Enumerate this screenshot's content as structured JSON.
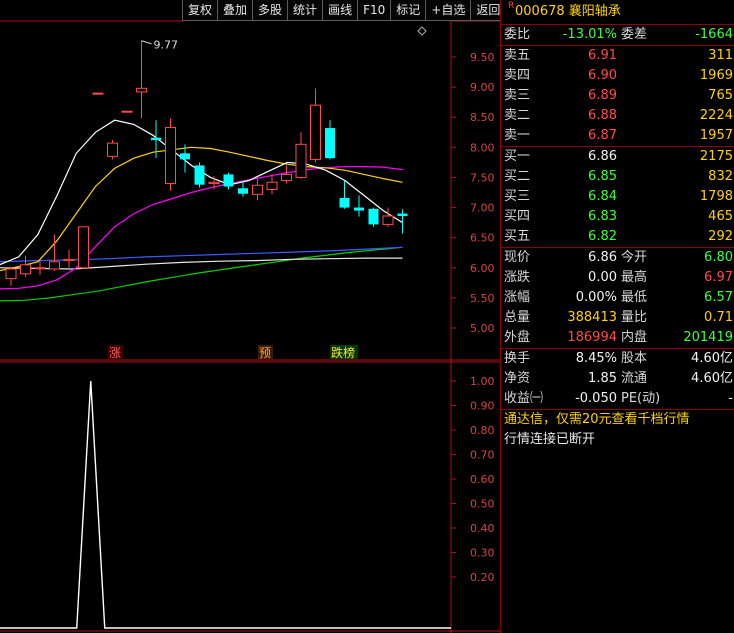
{
  "toolbar": [
    "复权",
    "叠加",
    "多股",
    "统计",
    "画线",
    "F10",
    "标记",
    "+自选",
    "返回"
  ],
  "chart": {
    "price_ticks": [
      "9.50",
      "9.00",
      "8.50",
      "8.00",
      "7.50",
      "7.00",
      "6.50",
      "6.00",
      "5.50",
      "5.00"
    ],
    "ind_ticks": [
      "1.00",
      "0.90",
      "0.80",
      "0.70",
      "0.60",
      "0.50",
      "0.40",
      "0.30",
      "0.20"
    ],
    "high_marker": "9.77",
    "tags": [
      "涨",
      "预",
      "跌榜"
    ],
    "colors": {
      "up": "#ff4a4a",
      "down": "#00ffff",
      "ma5": "#ffffff",
      "ma10": "#ffd200",
      "ma20": "#ff00ff",
      "ma60": "#00d000",
      "ma_blue": "#3c5cff",
      "axis": "#b0121b"
    }
  },
  "chart_data": {
    "type": "candlestick",
    "y_price_ticks": [
      9.5,
      9.0,
      8.5,
      8.0,
      7.5,
      7.0,
      6.5,
      6.0,
      5.5,
      5.0
    ],
    "y_indicator_ticks": [
      1.0,
      0.9,
      0.8,
      0.7,
      0.6,
      0.5,
      0.4,
      0.3,
      0.2
    ],
    "high_annotation": 9.77,
    "candles": [
      {
        "o": 5.82,
        "c": 5.98,
        "h": 6.02,
        "l": 5.7
      },
      {
        "o": 5.9,
        "c": 6.05,
        "h": 6.2,
        "l": 5.85
      },
      {
        "o": 6.0,
        "c": 6.0,
        "h": 6.12,
        "l": 5.88
      },
      {
        "o": 5.98,
        "c": 6.1,
        "h": 6.55,
        "l": 5.95
      },
      {
        "o": 6.12,
        "c": 6.14,
        "h": 6.3,
        "l": 6.0
      },
      {
        "o": 6.0,
        "c": 6.68,
        "h": 6.68,
        "l": 5.98
      },
      {
        "o": 8.9,
        "c": 8.9,
        "h": 8.9,
        "l": 8.9
      },
      {
        "o": 7.85,
        "c": 8.07,
        "h": 8.12,
        "l": 7.8
      },
      {
        "o": 8.6,
        "c": 8.6,
        "h": 8.6,
        "l": 8.6
      },
      {
        "o": 8.92,
        "c": 8.98,
        "h": 9.77,
        "l": 8.48
      },
      {
        "o": 8.16,
        "c": 8.12,
        "h": 8.45,
        "l": 7.82
      },
      {
        "o": 7.4,
        "c": 8.33,
        "h": 8.48,
        "l": 7.28
      },
      {
        "o": 7.9,
        "c": 7.8,
        "h": 8.05,
        "l": 7.58
      },
      {
        "o": 7.7,
        "c": 7.38,
        "h": 7.75,
        "l": 7.33
      },
      {
        "o": 7.4,
        "c": 7.42,
        "h": 7.52,
        "l": 7.3
      },
      {
        "o": 7.55,
        "c": 7.35,
        "h": 7.58,
        "l": 7.3
      },
      {
        "o": 7.32,
        "c": 7.23,
        "h": 7.45,
        "l": 7.18
      },
      {
        "o": 7.22,
        "c": 7.37,
        "h": 7.48,
        "l": 7.12
      },
      {
        "o": 7.3,
        "c": 7.42,
        "h": 7.55,
        "l": 7.22
      },
      {
        "o": 7.45,
        "c": 7.55,
        "h": 7.7,
        "l": 7.4
      },
      {
        "o": 7.5,
        "c": 8.05,
        "h": 8.25,
        "l": 7.48
      },
      {
        "o": 7.8,
        "c": 8.7,
        "h": 8.98,
        "l": 7.75
      },
      {
        "o": 8.32,
        "c": 7.82,
        "h": 8.45,
        "l": 7.8
      },
      {
        "o": 7.16,
        "c": 7.0,
        "h": 7.45,
        "l": 6.98
      },
      {
        "o": 7.0,
        "c": 6.95,
        "h": 7.2,
        "l": 6.85
      },
      {
        "o": 6.98,
        "c": 6.72,
        "h": 7.0,
        "l": 6.68
      },
      {
        "o": 6.72,
        "c": 6.86,
        "h": 7.0,
        "l": 6.68
      },
      {
        "o": 6.9,
        "c": 6.86,
        "h": 6.97,
        "l": 6.57
      }
    ],
    "ma5": [
      6.05,
      6.18,
      6.55,
      7.2,
      7.9,
      8.25,
      8.45,
      8.38,
      8.2,
      7.95,
      7.7,
      7.5,
      7.38,
      7.45,
      7.6,
      7.75,
      7.72,
      7.62,
      7.45,
      7.2,
      6.95,
      6.75
    ],
    "ma10": [
      5.95,
      6.02,
      6.1,
      6.45,
      6.9,
      7.35,
      7.65,
      7.82,
      7.92,
      7.96,
      8.0,
      7.98,
      7.92,
      7.85,
      7.78,
      7.72,
      7.68,
      7.66,
      7.62,
      7.55,
      7.48,
      7.42
    ],
    "ma20": [
      5.65,
      5.66,
      5.7,
      5.8,
      6.0,
      6.35,
      6.68,
      6.9,
      7.05,
      7.15,
      7.25,
      7.33,
      7.4,
      7.46,
      7.52,
      7.58,
      7.63,
      7.66,
      7.68,
      7.68,
      7.67,
      7.63
    ],
    "ma60": [
      5.45,
      5.46,
      5.5,
      5.56,
      5.62,
      5.7,
      5.78,
      5.85,
      5.92,
      5.98,
      6.04,
      6.1,
      6.16,
      6.21,
      6.26,
      6.3,
      6.34
    ],
    "ma_white": [
      6.0,
      5.99,
      5.98,
      6.02,
      6.06,
      6.09,
      6.11,
      6.12,
      6.14,
      6.15,
      6.16,
      6.16
    ],
    "ma_blue": [
      6.1,
      6.12,
      6.13,
      6.15,
      6.18,
      6.2,
      6.22,
      6.24,
      6.26,
      6.28,
      6.31,
      6.34
    ],
    "indicator_spike": {
      "base": 0.0,
      "peak": 1.0
    }
  },
  "quote": {
    "r_mark": "R",
    "code": "000678",
    "name": "襄阳轴承",
    "weibi_label": "委比",
    "weibi_value": "-13.01%",
    "weicha_label": "委差",
    "weicha_value": "-1664",
    "sells": [
      {
        "label": "卖五",
        "price": "6.91",
        "vol": "311"
      },
      {
        "label": "卖四",
        "price": "6.90",
        "vol": "1969"
      },
      {
        "label": "卖三",
        "price": "6.89",
        "vol": "765"
      },
      {
        "label": "卖二",
        "price": "6.88",
        "vol": "2224"
      },
      {
        "label": "卖一",
        "price": "6.87",
        "vol": "1957"
      }
    ],
    "buys": [
      {
        "label": "买一",
        "price": "6.86",
        "vol": "2175",
        "pc": "white"
      },
      {
        "label": "买二",
        "price": "6.85",
        "vol": "832",
        "pc": "green"
      },
      {
        "label": "买三",
        "price": "6.84",
        "vol": "1798",
        "pc": "green"
      },
      {
        "label": "买四",
        "price": "6.83",
        "vol": "465",
        "pc": "green"
      },
      {
        "label": "买五",
        "price": "6.82",
        "vol": "292",
        "pc": "green"
      }
    ],
    "stats": [
      {
        "l1": "现价",
        "v1": "6.86",
        "c1": "white",
        "l2": "今开",
        "v2": "6.80",
        "c2": "green"
      },
      {
        "l1": "涨跌",
        "v1": "0.00",
        "c1": "white",
        "l2": "最高",
        "v2": "6.97",
        "c2": "red"
      },
      {
        "l1": "涨幅",
        "v1": "0.00%",
        "c1": "white",
        "l2": "最低",
        "v2": "6.57",
        "c2": "green"
      },
      {
        "l1": "总量",
        "v1": "388413",
        "c1": "yellow",
        "l2": "量比",
        "v2": "0.71",
        "c2": "yellow"
      },
      {
        "l1": "外盘",
        "v1": "186994",
        "c1": "red",
        "l2": "内盘",
        "v2": "201419",
        "c2": "green"
      }
    ],
    "stats2": [
      {
        "l1": "换手",
        "v1": "8.45%",
        "c1": "white",
        "l2": "股本",
        "v2": "4.60亿",
        "c2": "white"
      },
      {
        "l1": "净资",
        "v1": "1.85",
        "c1": "white",
        "l2": "流通",
        "v2": "4.60亿",
        "c2": "white"
      },
      {
        "l1": "收益㈠",
        "v1": "-0.050",
        "c1": "white",
        "l2": "PE(动)",
        "v2": "-",
        "c2": "white"
      }
    ],
    "ad_text": "通达信，仅需20元查看千档行情",
    "disconnect_text": "行情连接已断开"
  }
}
